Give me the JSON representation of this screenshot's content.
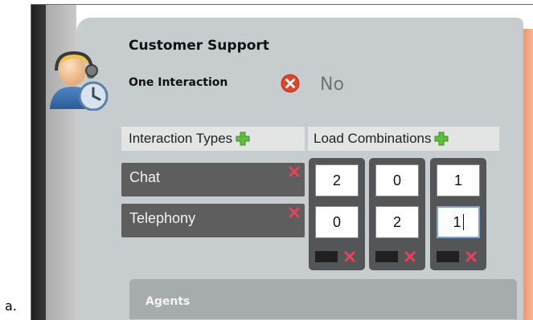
{
  "caption": "a.",
  "panel": {
    "title": "Customer Support",
    "one_interaction": {
      "label": "One Interaction",
      "value": "No"
    }
  },
  "headers": {
    "interaction_types": "Interaction Types",
    "load_combinations": "Load Combinations"
  },
  "interaction_types": [
    {
      "label": "Chat"
    },
    {
      "label": "Telephony"
    }
  ],
  "load_combinations": [
    {
      "chat": "2",
      "telephony": "0"
    },
    {
      "chat": "0",
      "telephony": "2"
    },
    {
      "chat": "1",
      "telephony": "1"
    }
  ],
  "agents": {
    "label": "Agents"
  },
  "colors": {
    "card": "#c7cdcf",
    "type_row": "#5e5e5e",
    "remove_x": "#e8415b",
    "add_plus": "#5fbf3a",
    "accent_edge": "#f2946a"
  }
}
